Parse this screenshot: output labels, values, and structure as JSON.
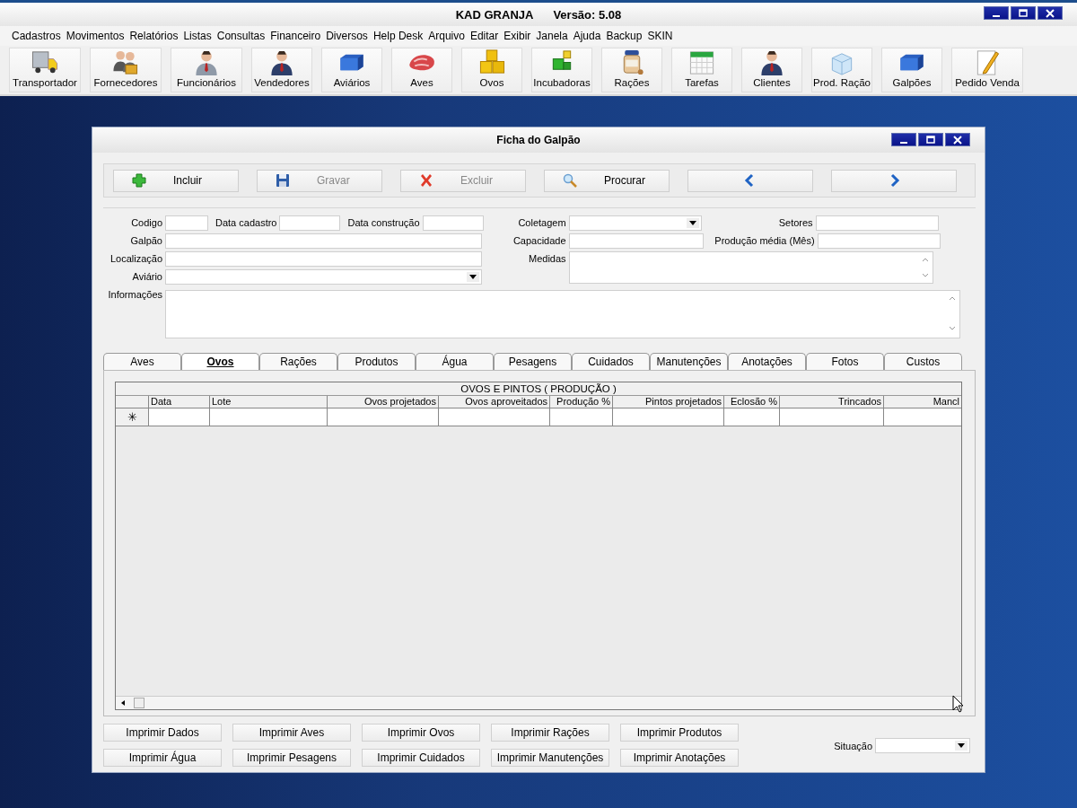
{
  "app_window": {
    "title": "KAD GRANJA",
    "version": "Versão: 5.08"
  },
  "menu": [
    "Cadastros",
    "Movimentos",
    "Relatórios",
    "Listas",
    "Consultas",
    "Financeiro",
    "Diversos",
    "Help Desk",
    "Arquivo",
    "Editar",
    "Exibir",
    "Janela",
    "Ajuda",
    "Backup",
    "SKIN"
  ],
  "toolbar": [
    {
      "label": "Transportador",
      "kind": "truck"
    },
    {
      "label": "Fornecedores",
      "kind": "people"
    },
    {
      "label": "Funcionários",
      "kind": "person"
    },
    {
      "label": "Vendedores",
      "kind": "person"
    },
    {
      "label": "Aviários",
      "kind": "container"
    },
    {
      "label": "Aves",
      "kind": "meat"
    },
    {
      "label": "Ovos",
      "kind": "boxes"
    },
    {
      "label": "Incubadoras",
      "kind": "cubes"
    },
    {
      "label": "Rações",
      "kind": "jar"
    },
    {
      "label": "Tarefas",
      "kind": "calendar"
    },
    {
      "label": "Clientes",
      "kind": "person"
    },
    {
      "label": "Prod. Ração",
      "kind": "box"
    },
    {
      "label": "Galpões",
      "kind": "container"
    },
    {
      "label": "Pedido Venda",
      "kind": "note"
    }
  ],
  "form_window": {
    "title": "Ficha do Galpão",
    "actions": [
      {
        "label": "Incluir",
        "kind": "add",
        "disabled": false
      },
      {
        "label": "Gravar",
        "kind": "save",
        "disabled": true
      },
      {
        "label": "Excluir",
        "kind": "delete",
        "disabled": true
      },
      {
        "label": "Procurar",
        "kind": "search",
        "disabled": false
      },
      {
        "kind": "prev"
      },
      {
        "kind": "next"
      }
    ],
    "left_rows": [
      [
        {
          "label": "Codigo",
          "kind": "text"
        },
        {
          "label": "Data cadastro",
          "kind": "text"
        },
        {
          "label": "Data construção",
          "kind": "text"
        }
      ],
      [
        {
          "label": "Galpão",
          "kind": "text"
        }
      ],
      [
        {
          "label": "Localização",
          "kind": "text"
        }
      ],
      [
        {
          "label": "Aviário",
          "kind": "combo"
        }
      ]
    ],
    "right_rows": [
      [
        {
          "label": "Coletagem",
          "kind": "combo"
        },
        {
          "label": "Setores",
          "kind": "text"
        }
      ],
      [
        {
          "label": "Capacidade",
          "kind": "text"
        },
        {
          "label": "Produção média (Mês)",
          "kind": "text"
        }
      ],
      [
        {
          "label": "Medidas",
          "kind": "memo"
        }
      ]
    ],
    "notes": {
      "label": "Informações",
      "kind": "memo"
    },
    "tabs": [
      {
        "label": "Aves",
        "selected": false
      },
      {
        "label": "Ovos",
        "selected": true
      },
      {
        "label": "Rações",
        "selected": false
      },
      {
        "label": "Produtos",
        "selected": false
      },
      {
        "label": "Água",
        "selected": false
      },
      {
        "label": "Pesagens",
        "selected": false
      },
      {
        "label": "Cuidados",
        "selected": false
      },
      {
        "label": "Manutenções",
        "selected": false
      },
      {
        "label": "Anotações",
        "selected": false
      },
      {
        "label": "Fotos",
        "selected": false
      },
      {
        "label": "Custos",
        "selected": false
      }
    ],
    "grid": {
      "caption": "OVOS E PINTOS ( PRODUÇÃO )",
      "new_row_marker": "✳",
      "columns": [
        "Data",
        "Lote",
        "Ovos projetados",
        "Ovos aproveitados",
        "Produção %",
        "Pintos projetados",
        "Eclosão %",
        "Trincados",
        "Mancl"
      ]
    },
    "print_buttons": [
      "Imprimir Dados",
      "Imprimir Aves",
      "Imprimir Ovos",
      "Imprimir Rações",
      "Imprimir Produtos",
      "Imprimir Água",
      "Imprimir Pesagens",
      "Imprimir Cuidados",
      "Imprimir Manutenções",
      "Imprimir Anotações"
    ],
    "status": {
      "label": "Situação",
      "kind": "combo"
    }
  }
}
